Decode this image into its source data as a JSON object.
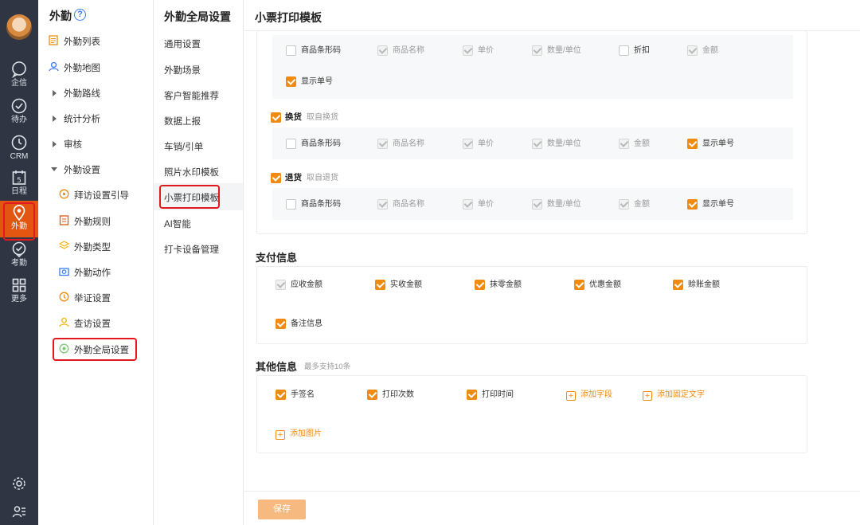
{
  "rail": {
    "items": [
      {
        "label": "企信",
        "icon": "chat-bubble-icon"
      },
      {
        "label": "待办",
        "icon": "check-circle-icon"
      },
      {
        "label": "CRM",
        "icon": "clock-icon"
      },
      {
        "label": "日程",
        "icon": "calendar-icon",
        "day": "5"
      },
      {
        "label": "外勤",
        "icon": "location-pin-icon"
      },
      {
        "label": "考勤",
        "icon": "attendance-icon"
      },
      {
        "label": "更多",
        "icon": "grid-icon"
      }
    ],
    "bottom": [
      {
        "icon": "settings-icon"
      },
      {
        "icon": "user-list-icon"
      }
    ]
  },
  "nav1": {
    "title": "外勤",
    "help": "?",
    "items": [
      {
        "label": "外勤列表",
        "icon": "list-icon"
      },
      {
        "label": "外勤地图",
        "icon": "map-person-icon"
      },
      {
        "label": "外勤路线",
        "arrow": "right"
      },
      {
        "label": "统计分析",
        "arrow": "right"
      },
      {
        "label": "审核",
        "arrow": "right"
      },
      {
        "label": "外勤设置",
        "arrow": "down"
      },
      {
        "label": "拜访设置引导",
        "icon": "guide-icon"
      },
      {
        "label": "外勤规则",
        "icon": "rule-icon"
      },
      {
        "label": "外勤类型",
        "icon": "layers-icon"
      },
      {
        "label": "外勤动作",
        "icon": "camera-icon"
      },
      {
        "label": "举证设置",
        "icon": "evidence-icon"
      },
      {
        "label": "查访设置",
        "icon": "inspect-icon"
      },
      {
        "label": "外勤全局设置",
        "icon": "global-settings-icon"
      }
    ]
  },
  "nav2": {
    "title": "外勤全局设置",
    "items": [
      "通用设置",
      "外勤场景",
      "客户智能推荐",
      "数据上报",
      "车销/引单",
      "照片水印模板",
      "小票打印模板",
      "AI智能",
      "打卡设备管理"
    ]
  },
  "main": {
    "title": "小票打印模板",
    "top_group": {
      "row1": [
        {
          "label": "商品条形码",
          "state": "off"
        },
        {
          "label": "商品名称",
          "state": "disabled"
        },
        {
          "label": "单价",
          "state": "disabled"
        },
        {
          "label": "数量/单位",
          "state": "disabled"
        },
        {
          "label": "折扣",
          "state": "off"
        },
        {
          "label": "金额",
          "state": "disabled"
        }
      ],
      "row2": [
        {
          "label": "显示单号",
          "state": "on"
        }
      ]
    },
    "exchange": {
      "label": "换货",
      "sub": "取自换货",
      "state": "on",
      "fields": [
        {
          "label": "商品条形码",
          "state": "off"
        },
        {
          "label": "商品名称",
          "state": "disabled"
        },
        {
          "label": "单价",
          "state": "disabled"
        },
        {
          "label": "数量/单位",
          "state": "disabled"
        },
        {
          "label": "金额",
          "state": "disabled"
        },
        {
          "label": "显示单号",
          "state": "on"
        }
      ]
    },
    "returns": {
      "label": "退货",
      "sub": "取自退货",
      "state": "on",
      "fields": [
        {
          "label": "商品条形码",
          "state": "off"
        },
        {
          "label": "商品名称",
          "state": "disabled"
        },
        {
          "label": "单价",
          "state": "disabled"
        },
        {
          "label": "数量/单位",
          "state": "disabled"
        },
        {
          "label": "金额",
          "state": "disabled"
        },
        {
          "label": "显示单号",
          "state": "on"
        }
      ]
    },
    "payment": {
      "title": "支付信息",
      "fields": [
        {
          "label": "应收金额",
          "state": "disabled"
        },
        {
          "label": "实收金额",
          "state": "on"
        },
        {
          "label": "抹零金额",
          "state": "on"
        },
        {
          "label": "优惠金额",
          "state": "on"
        },
        {
          "label": "赊账金额",
          "state": "on"
        },
        {
          "label": "备注信息",
          "state": "on"
        }
      ]
    },
    "other": {
      "title": "其他信息",
      "hint": "最多支持10条",
      "fields": [
        {
          "label": "手签名",
          "state": "on"
        },
        {
          "label": "打印次数",
          "state": "on"
        },
        {
          "label": "打印时间",
          "state": "on"
        }
      ],
      "add_field": "添加字段",
      "add_fixed_text": "添加固定文字",
      "add_image": "添加图片"
    },
    "save": "保存"
  },
  "colors": {
    "accent": "#f08a10",
    "rail_bg": "#2f3542",
    "rail_active": "#e25612",
    "highlight_border": "#e0191f"
  }
}
